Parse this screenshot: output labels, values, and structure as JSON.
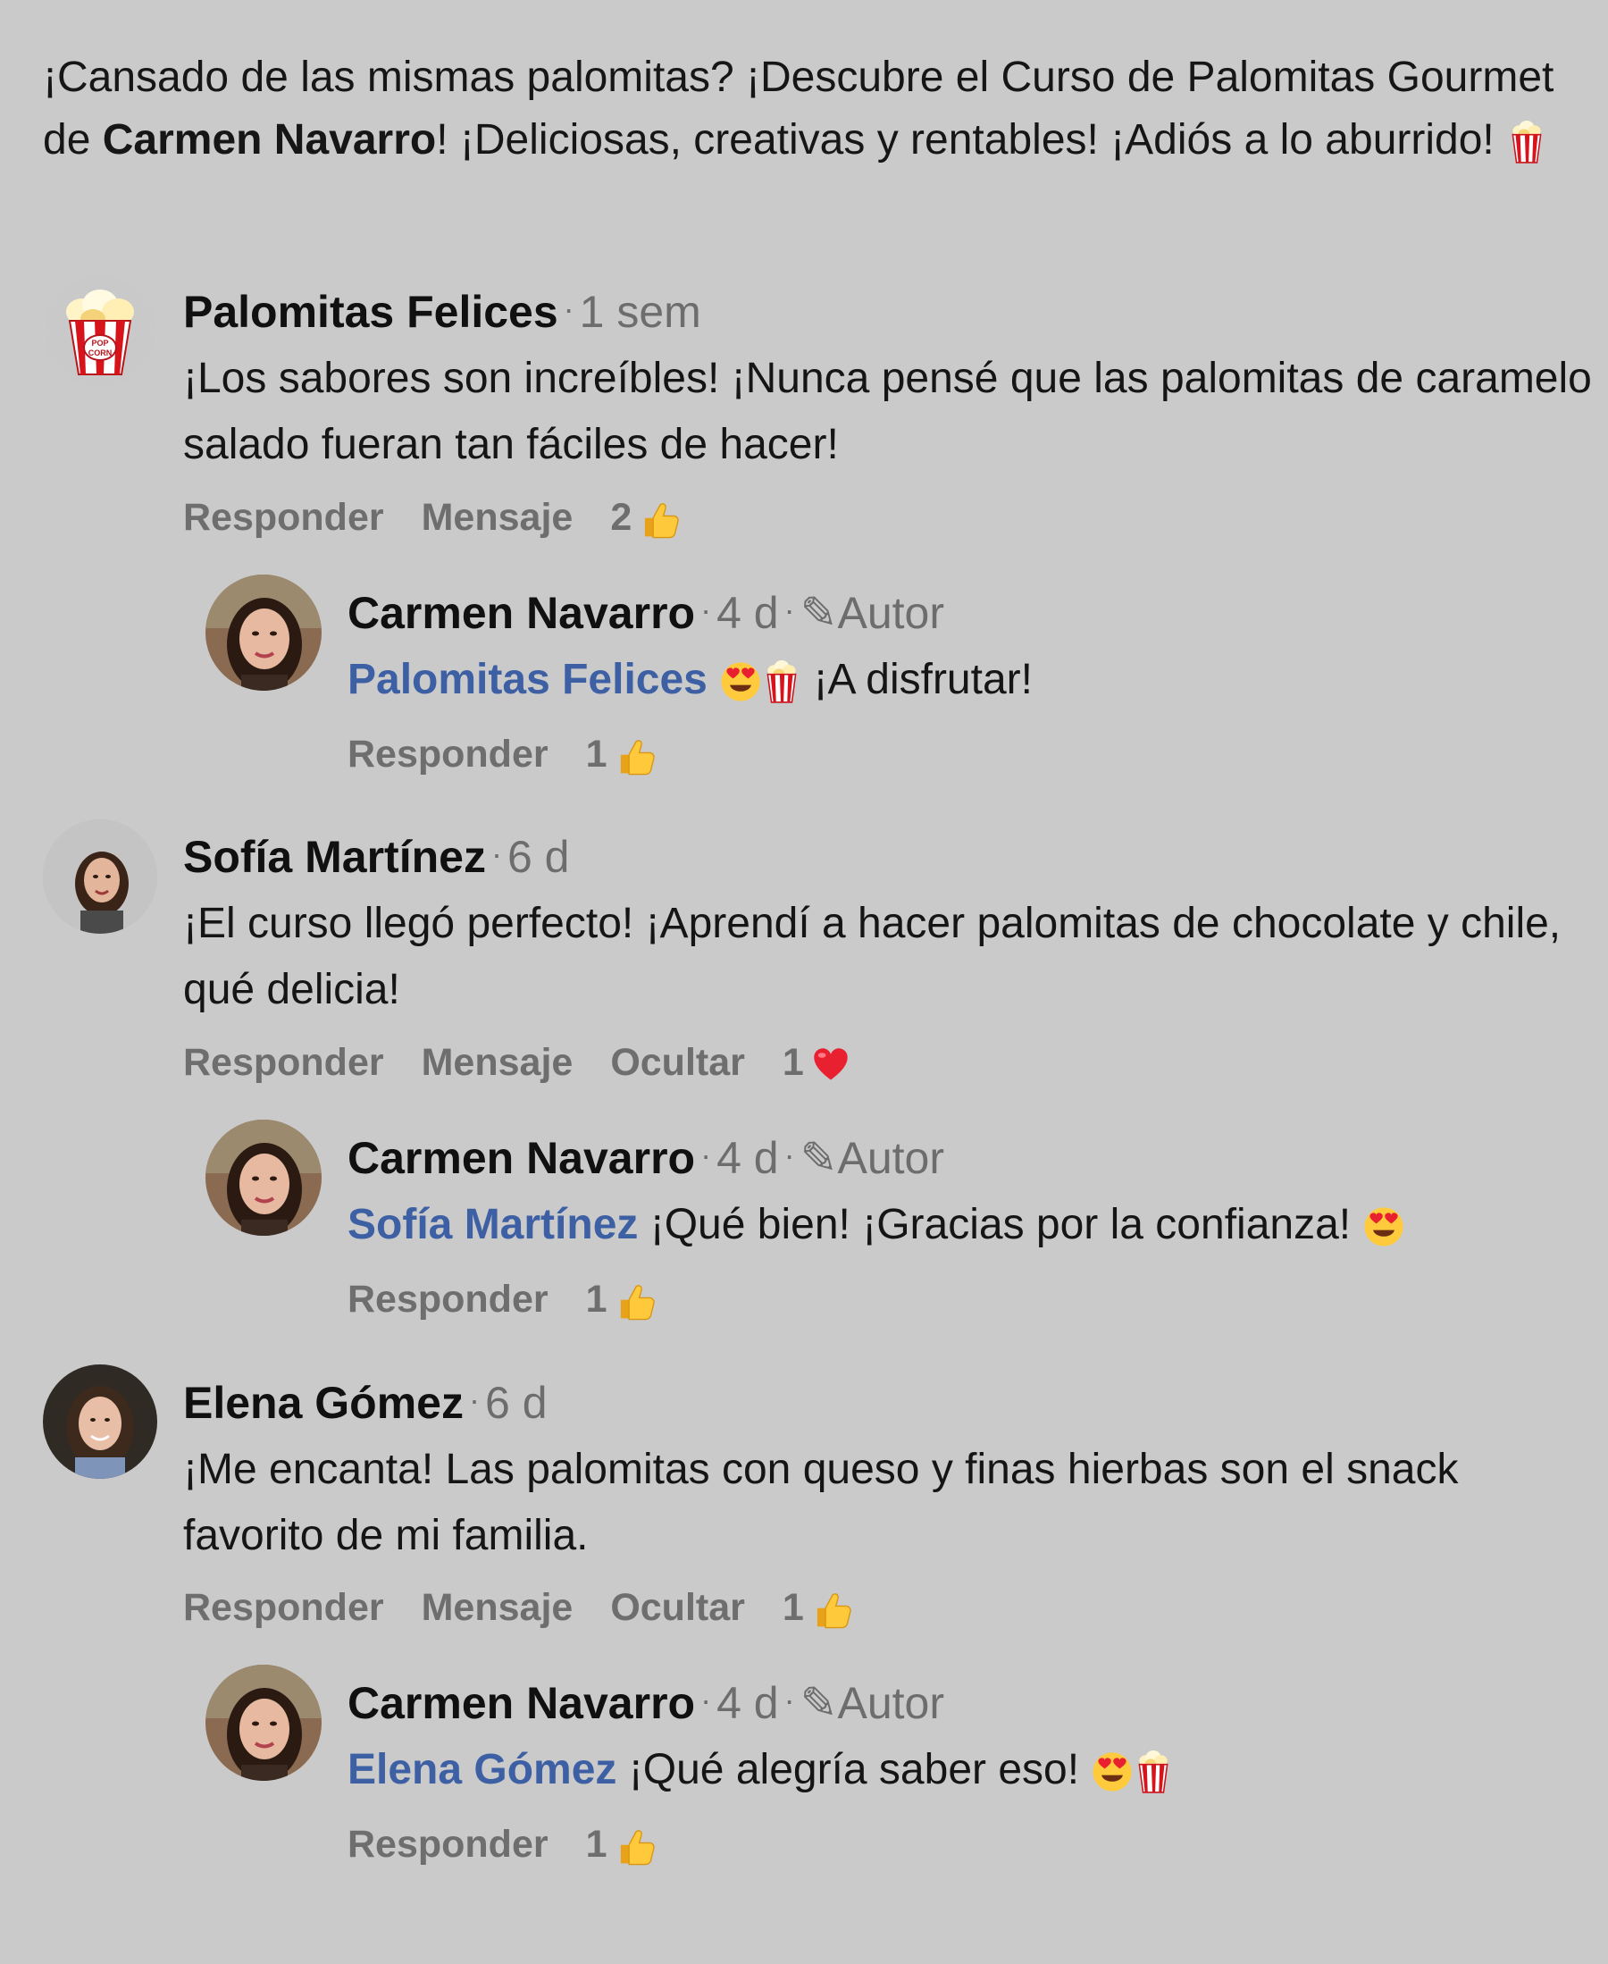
{
  "post": {
    "text_before": "¡Cansado de las mismas palomitas? ¡Descubre el Curso de Palomitas Gourmet de ",
    "author": "Carmen Navarro",
    "text_after": "! ¡Deliciosas, creativas y rentables! ¡Adiós a lo aburrido! ",
    "emoji": "popcorn-icon"
  },
  "comments": [
    {
      "name": "Palomitas Felices",
      "time": "1 sem",
      "text": "¡Los sabores son increíbles! ¡Nunca pensé que las palomitas de caramelo salado fueran tan fáciles de hacer!",
      "actions": [
        "Responder",
        "Mensaje"
      ],
      "reaction_count": "2",
      "reaction": "thumbs-up-icon",
      "reply": {
        "name": "Carmen Navarro",
        "time": "4 d",
        "badge": "Autor",
        "mention": "Palomitas Felices",
        "text": "¡A disfrutar!",
        "action": "Responder",
        "reaction_count": "1",
        "reaction": "thumbs-up-icon"
      }
    },
    {
      "name": "Sofía Martínez",
      "time": "6 d",
      "text": "¡El curso llegó perfecto! ¡Aprendí a hacer palomitas de chocolate y chile, qué delicia!",
      "actions": [
        "Responder",
        "Mensaje",
        "Ocultar"
      ],
      "reaction_count": "1",
      "reaction": "heart-icon",
      "reply": {
        "name": "Carmen Navarro",
        "time": "4 d",
        "badge": "Autor",
        "mention": "Sofía Martínez",
        "text": "¡Qué bien! ¡Gracias por la confianza!",
        "action": "Responder",
        "reaction_count": "1",
        "reaction": "thumbs-up-icon"
      }
    },
    {
      "name": "Elena Gómez",
      "time": "6 d",
      "text": "¡Me encanta! Las palomitas con queso y finas hierbas son el snack favorito de mi familia.",
      "actions": [
        "Responder",
        "Mensaje",
        "Ocultar"
      ],
      "reaction_count": "1",
      "reaction": "thumbs-up-icon",
      "reply": {
        "name": "Carmen Navarro",
        "time": "4 d",
        "badge": "Autor",
        "mention": "Elena Gómez",
        "text": "¡Qué alegría saber eso!",
        "action": "Responder",
        "reaction_count": "1",
        "reaction": "thumbs-up-icon"
      }
    }
  ],
  "colors": {
    "background": "#cacaca",
    "mention": "#3d5fa4",
    "meta": "#6d6d6d",
    "action": "#6e6e6e"
  }
}
